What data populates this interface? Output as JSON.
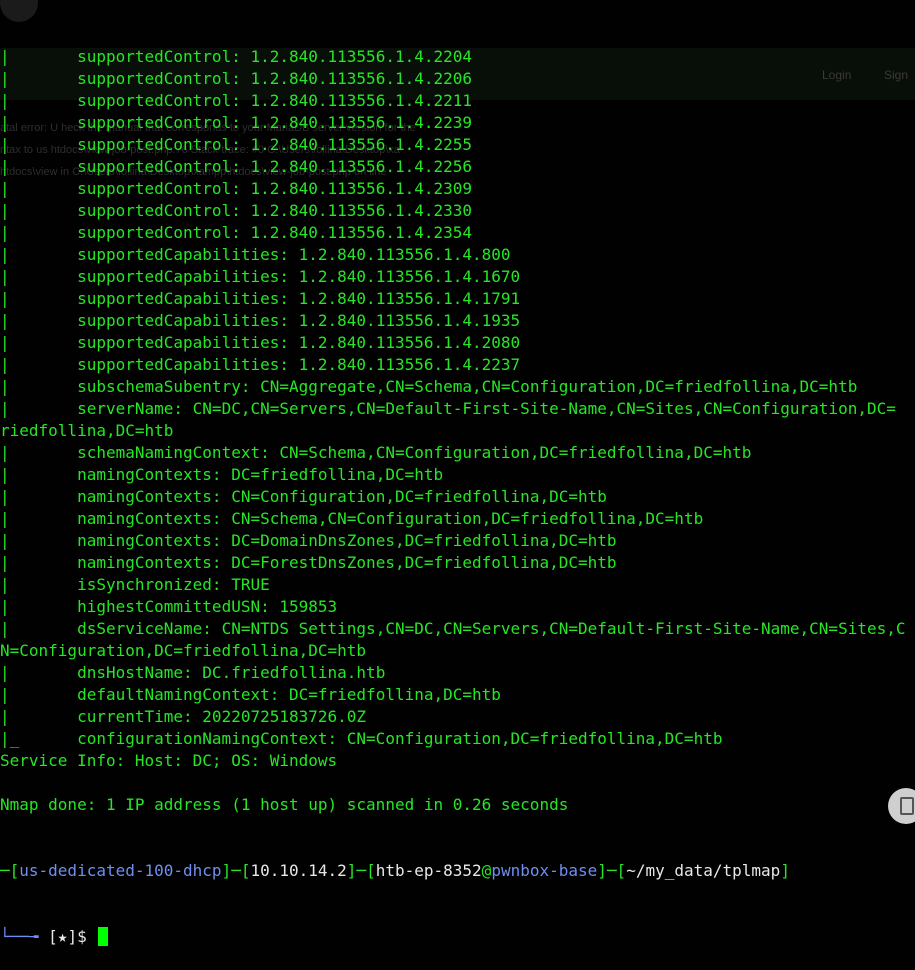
{
  "background_page": {
    "nav_login": "Login",
    "nav_signup": "Sign",
    "error_line_1": "atal error: U                                                                    heck the manual that corresponds to your MariaDB server version for the",
    "error_line_2": "ntax to us                                                                 htdocs\\view-job-post.php:76 Stack trace: #0 C:\\Users\\follina\\Desktop\\xa",
    "error_line_3": "htdocs\\view                                                              in C:\\Users\\follina\\Desktop\\xampp\\htdocs\\view-job-post.php on line"
  },
  "terminal": {
    "output_lines": [
      {
        "prefix": "|",
        "text": "       supportedControl: 1.2.840.113556.1.4.2204"
      },
      {
        "prefix": "|",
        "text": "       supportedControl: 1.2.840.113556.1.4.2206"
      },
      {
        "prefix": "|",
        "text": "       supportedControl: 1.2.840.113556.1.4.2211"
      },
      {
        "prefix": "|",
        "text": "       supportedControl: 1.2.840.113556.1.4.2239"
      },
      {
        "prefix": "|",
        "text": "       supportedControl: 1.2.840.113556.1.4.2255"
      },
      {
        "prefix": "|",
        "text": "       supportedControl: 1.2.840.113556.1.4.2256"
      },
      {
        "prefix": "|",
        "text": "       supportedControl: 1.2.840.113556.1.4.2309"
      },
      {
        "prefix": "|",
        "text": "       supportedControl: 1.2.840.113556.1.4.2330"
      },
      {
        "prefix": "|",
        "text": "       supportedControl: 1.2.840.113556.1.4.2354"
      },
      {
        "prefix": "|",
        "text": "       supportedCapabilities: 1.2.840.113556.1.4.800"
      },
      {
        "prefix": "|",
        "text": "       supportedCapabilities: 1.2.840.113556.1.4.1670"
      },
      {
        "prefix": "|",
        "text": "       supportedCapabilities: 1.2.840.113556.1.4.1791"
      },
      {
        "prefix": "|",
        "text": "       supportedCapabilities: 1.2.840.113556.1.4.1935"
      },
      {
        "prefix": "|",
        "text": "       supportedCapabilities: 1.2.840.113556.1.4.2080"
      },
      {
        "prefix": "|",
        "text": "       supportedCapabilities: 1.2.840.113556.1.4.2237"
      },
      {
        "prefix": "|",
        "text": "       subschemaSubentry: CN=Aggregate,CN=Schema,CN=Configuration,DC=friedfollina,DC=htb"
      },
      {
        "prefix": "|",
        "text": "       serverName: CN=DC,CN=Servers,CN=Default-First-Site-Name,CN=Sites,CN=Configuration,DC="
      },
      {
        "prefix": "",
        "text": "riedfollina,DC=htb"
      },
      {
        "prefix": "|",
        "text": "       schemaNamingContext: CN=Schema,CN=Configuration,DC=friedfollina,DC=htb"
      },
      {
        "prefix": "|",
        "text": "       namingContexts: DC=friedfollina,DC=htb"
      },
      {
        "prefix": "|",
        "text": "       namingContexts: CN=Configuration,DC=friedfollina,DC=htb"
      },
      {
        "prefix": "|",
        "text": "       namingContexts: CN=Schema,CN=Configuration,DC=friedfollina,DC=htb"
      },
      {
        "prefix": "|",
        "text": "       namingContexts: DC=DomainDnsZones,DC=friedfollina,DC=htb"
      },
      {
        "prefix": "|",
        "text": "       namingContexts: DC=ForestDnsZones,DC=friedfollina,DC=htb"
      },
      {
        "prefix": "|",
        "text": "       isSynchronized: TRUE"
      },
      {
        "prefix": "|",
        "text": "       highestCommittedUSN: 159853"
      },
      {
        "prefix": "|",
        "text": "       dsServiceName: CN=NTDS Settings,CN=DC,CN=Servers,CN=Default-First-Site-Name,CN=Sites,C"
      },
      {
        "prefix": "",
        "text": "N=Configuration,DC=friedfollina,DC=htb"
      },
      {
        "prefix": "|",
        "text": "       dnsHostName: DC.friedfollina.htb"
      },
      {
        "prefix": "|",
        "text": "       defaultNamingContext: DC=friedfollina,DC=htb"
      },
      {
        "prefix": "|",
        "text": "       currentTime: 20220725183726.0Z"
      },
      {
        "prefix": "|_",
        "text": "      configurationNamingContext: CN=Configuration,DC=friedfollina,DC=htb"
      },
      {
        "prefix": "",
        "text": "Service Info: Host: DC; OS: Windows"
      },
      {
        "prefix": "",
        "text": ""
      },
      {
        "prefix": "",
        "text": "Nmap done: 1 IP address (1 host up) scanned in 0.26 seconds"
      }
    ],
    "prompt": {
      "host_label": "us-dedicated-100-dhcp",
      "ip": "10.10.14.2",
      "user": "htb-ep-8352",
      "at": "@",
      "machine": "pwnbox-base",
      "cwd": "~/my_data/tplmap",
      "line2_branch": "└──╼ ",
      "marker": "[★]$ "
    }
  },
  "colors": {
    "terminal_green": "#26e626",
    "prompt_blue": "#6f8ff0",
    "prompt_white": "#e8e8e8",
    "background": "#010101"
  }
}
